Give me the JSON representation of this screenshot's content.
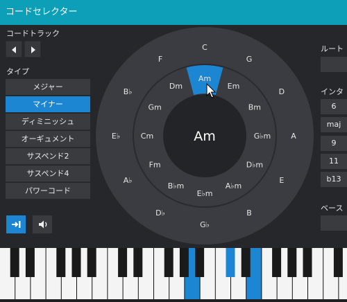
{
  "window": {
    "title": "コードセレクター"
  },
  "chord_track": {
    "label": "コードトラック",
    "prev_icon": "triangle-left",
    "next_icon": "triangle-right"
  },
  "type": {
    "label": "タイプ",
    "items": [
      "メジャー",
      "マイナー",
      "ディミニッシュ",
      "オーギュメント",
      "サスペンド2",
      "サスペンド4",
      "パワーコード"
    ],
    "selected": "マイナー"
  },
  "buttons": {
    "insert_icon": "insert-arrow-icon",
    "speaker_icon": "speaker-icon"
  },
  "circle": {
    "center": "Am",
    "outer": [
      "C",
      "G",
      "D",
      "A",
      "E",
      "B",
      "G♭",
      "D♭",
      "A♭",
      "E♭",
      "B♭",
      "F"
    ],
    "inner": [
      "Am",
      "Em",
      "Bm",
      "G♭m",
      "D♭m",
      "A♭m",
      "E♭m",
      "B♭m",
      "Fm",
      "Cm",
      "Gm",
      "Dm"
    ],
    "selected": "Am",
    "accent": "#1d86d3"
  },
  "right": {
    "root_label": "ルート",
    "intervals_label": "インターバ",
    "intervals": [
      "6",
      "maj",
      "9",
      "11",
      "b13"
    ],
    "bass_label": "ベース"
  },
  "keyboard": {
    "highlight_color": "#1d86d3"
  }
}
